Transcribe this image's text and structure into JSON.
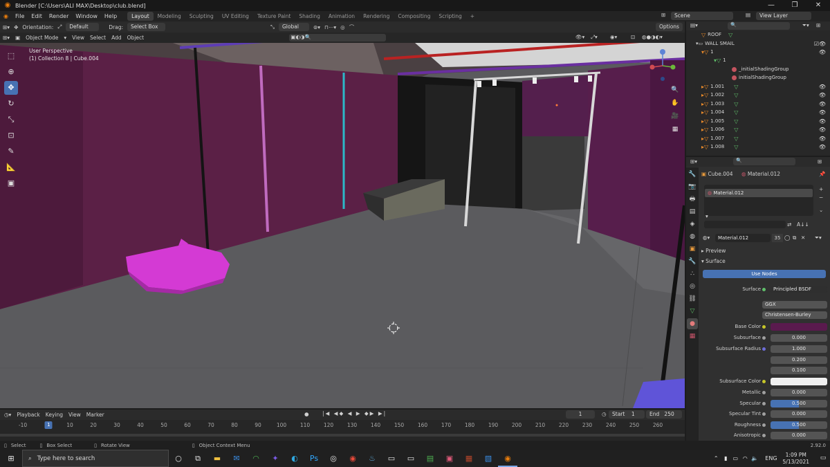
{
  "window": {
    "title": "Blender [C:\\Users\\ALI MAX\\Desktop\\club.blend]"
  },
  "menu": [
    "File",
    "Edit",
    "Render",
    "Window",
    "Help"
  ],
  "workspaces": [
    "Layout",
    "Modeling",
    "Sculpting",
    "UV Editing",
    "Texture Paint",
    "Shading",
    "Animation",
    "Rendering",
    "Compositing",
    "Scripting"
  ],
  "scene": {
    "label": "Scene",
    "view_layer": "View Layer"
  },
  "toolbar": {
    "orientation_label": "Orientation:",
    "orientation_value": "Default",
    "drag_label": "Drag:",
    "drag_value": "Select Box",
    "transform_value": "Global",
    "options_label": "Options"
  },
  "viewport_header": {
    "mode": "Object Mode",
    "menus": [
      "View",
      "Select",
      "Add",
      "Object"
    ]
  },
  "viewport": {
    "perspective": "User Perspective",
    "collection": "(1) Collection 8 | Cube.004"
  },
  "outliner": {
    "rows": [
      {
        "label": "ROOF",
        "kind": "object"
      },
      {
        "label": "WALL SMAIL",
        "kind": "collection"
      },
      {
        "label": "1",
        "kind": "object"
      },
      {
        "label": "1",
        "kind": "mesh"
      },
      {
        "label": "_initialShadingGroup",
        "kind": "material"
      },
      {
        "label": "initialShadingGroup",
        "kind": "material"
      },
      {
        "label": "1.001",
        "kind": "object"
      },
      {
        "label": "1.002",
        "kind": "object"
      },
      {
        "label": "1.003",
        "kind": "object"
      },
      {
        "label": "1.004",
        "kind": "object"
      },
      {
        "label": "1.005",
        "kind": "object"
      },
      {
        "label": "1.006",
        "kind": "object"
      },
      {
        "label": "1.007",
        "kind": "object"
      },
      {
        "label": "1.008",
        "kind": "object"
      }
    ]
  },
  "properties": {
    "object_name": "Cube.004",
    "material_name": "Material.012",
    "slot_name": "Material.012",
    "datablock_name": "Material.012",
    "user_count": "35",
    "panels": {
      "preview": "Preview",
      "surface": "Surface"
    },
    "use_nodes_label": "Use Nodes",
    "surface_label": "Surface",
    "surface_value": "Principled BSDF",
    "distribution": "GGX",
    "subsurface_method": "Christensen-Burley",
    "base_color_label": "Base Color",
    "base_color": "#5a1a4e",
    "subsurface_color": "#f0f0f0",
    "fields": [
      {
        "label": "Subsurface",
        "value": "0.000",
        "fill": 0
      },
      {
        "label": "Subsurface Radius",
        "value": "1.000",
        "fill": 0
      },
      {
        "label": "",
        "value": "0.200",
        "fill": 0
      },
      {
        "label": "",
        "value": "0.100",
        "fill": 0
      },
      {
        "label": "Subsurface Color",
        "value": "",
        "fill": 0
      },
      {
        "label": "Metallic",
        "value": "0.000",
        "fill": 0
      },
      {
        "label": "Specular",
        "value": "0.500",
        "fill": 0.5
      },
      {
        "label": "Specular Tint",
        "value": "0.000",
        "fill": 0
      },
      {
        "label": "Roughness",
        "value": "0.500",
        "fill": 0.5
      },
      {
        "label": "Anisotropic",
        "value": "0.000",
        "fill": 0
      }
    ]
  },
  "timeline": {
    "menus": [
      "Playback",
      "Keying",
      "View",
      "Marker"
    ],
    "current_frame": "1",
    "start_label": "Start",
    "start_value": "1",
    "end_label": "End",
    "end_value": "250",
    "ticks": [
      "-10",
      "0",
      "10",
      "20",
      "30",
      "40",
      "50",
      "60",
      "70",
      "80",
      "90",
      "100",
      "110",
      "120",
      "130",
      "140",
      "150",
      "160",
      "170",
      "180",
      "190",
      "200",
      "210",
      "220",
      "230",
      "240",
      "250",
      "260"
    ],
    "playhead": "1"
  },
  "status": {
    "select": "Select",
    "box_select": "Box Select",
    "rotate_view": "Rotate View",
    "context_menu": "Object Context Menu",
    "version": "2.92.0"
  },
  "taskbar": {
    "search_placeholder": "Type here to search",
    "language": "ENG",
    "time": "1:09 PM",
    "date": "5/13/2021"
  },
  "colors": {
    "accent": "#4772b3",
    "wall_purple": "#5b2046",
    "floor_grey": "#5a5a5d",
    "magenta_base": "#d43ad4"
  }
}
